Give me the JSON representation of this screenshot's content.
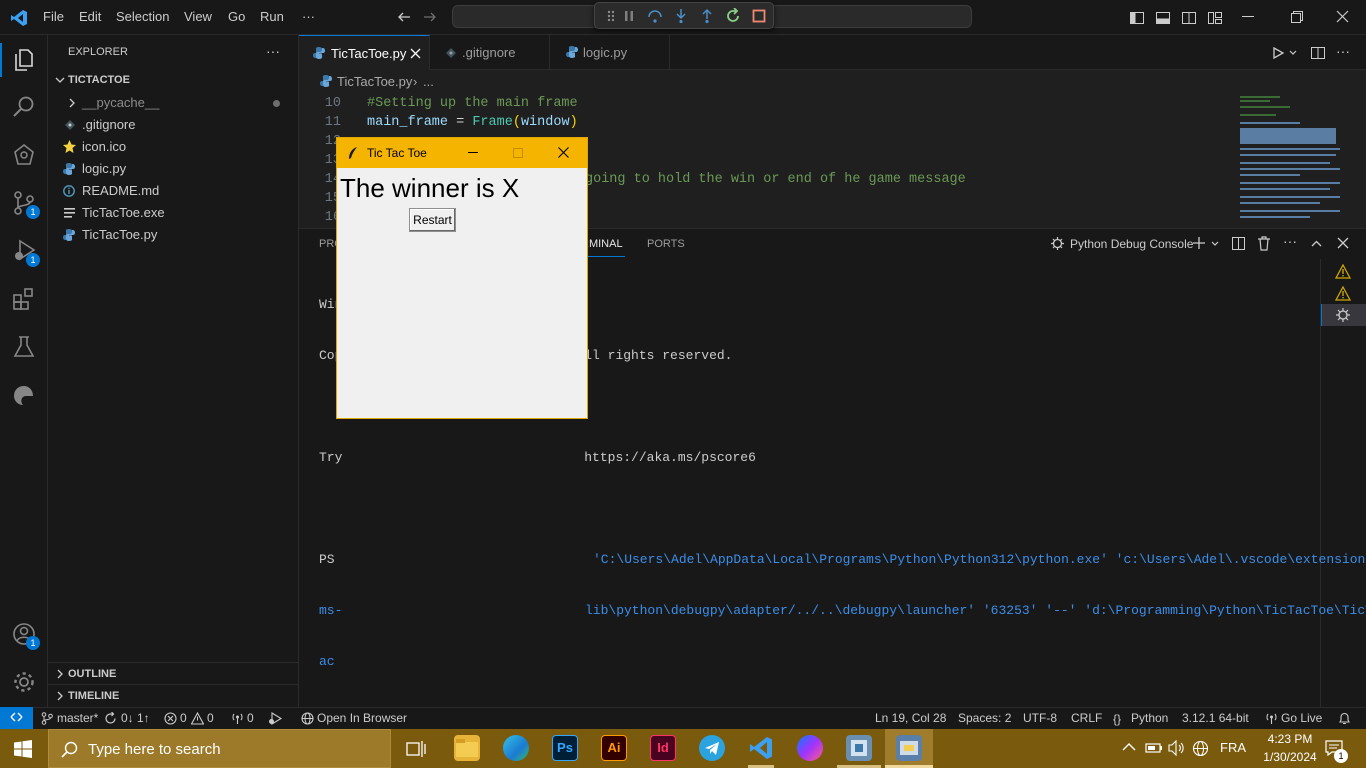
{
  "menu": [
    "File",
    "Edit",
    "Selection",
    "View",
    "Go",
    "Run",
    "···"
  ],
  "explorer": {
    "title": "EXPLORER",
    "more": "···",
    "root": "TICTACTOE",
    "items": [
      {
        "label": "__pycache__",
        "icon": "chevron-right"
      },
      {
        "label": ".gitignore",
        "icon": "git-diamond"
      },
      {
        "label": "icon.ico",
        "icon": "star"
      },
      {
        "label": "logic.py",
        "icon": "python"
      },
      {
        "label": "README.md",
        "icon": "info"
      },
      {
        "label": "TicTacToe.exe",
        "icon": "lines"
      },
      {
        "label": "TicTacToe.py",
        "icon": "python"
      }
    ],
    "outline": "OUTLINE",
    "timeline": "TIMELINE"
  },
  "activity_badges": {
    "scm": "1",
    "debug": "1",
    "accounts": "1"
  },
  "tabs": [
    {
      "label": "TicTacToe.py",
      "active": true
    },
    {
      "label": ".gitignore"
    },
    {
      "label": "logic.py"
    }
  ],
  "breadcrumb": {
    "file": "TicTacToe.py",
    "rest": "..."
  },
  "code": [
    {
      "n": "10",
      "text": "#Setting up the main frame"
    },
    {
      "n": "11",
      "text": "main_frame = Frame(window)"
    },
    {
      "n": "12",
      "text": ""
    },
    {
      "n": "13",
      "text": ""
    },
    {
      "n": "14",
      "text": "going to hold the win or end of he game message"
    },
    {
      "n": "15",
      "text": ""
    },
    {
      "n": "16",
      "text": ""
    }
  ],
  "panel": {
    "tab_problems": "PRO",
    "tab_terminal": "RMINAL",
    "tab_ports": "PORTS",
    "console": "Python Debug Console"
  },
  "terminal": [
    "Win",
    "Cop                               ll rights reserved.",
    "",
    "Try                               https://aka.ms/pscore6",
    "",
    "PS",
    "ms-",
    "ac"
  ],
  "terminal_cmd": [
    "'C:\\Users\\Adel\\AppData\\Local\\Programs\\Python\\Python312\\python.exe' 'c:\\Users\\Adel\\.vscode\\extensions\\",
    "lib\\python\\debugpy\\adapter/../..\\debugpy\\launcher' '63253' '--' 'd:\\Programming\\Python\\TicTacToe\\TicT"
  ],
  "tk": {
    "title": "Tic Tac Toe",
    "message": "The winner is X",
    "button": "Restart"
  },
  "status": {
    "branch": "master*",
    "sync": "0↓ 1↑",
    "errors": "0",
    "warnings": "0",
    "ports": "0",
    "open_browser": "Open In Browser",
    "position": "Ln 19, Col 28",
    "spaces": "Spaces: 2",
    "encoding": "UTF-8",
    "eol": "CRLF",
    "language": "Python",
    "interpreter": "3.12.1 64-bit",
    "golive": "Go Live"
  },
  "taskbar": {
    "search": "Type here to search",
    "lang": "FRA",
    "time": "4:23 PM",
    "date": "1/30/2024",
    "notif": "1"
  },
  "colors": {
    "accent": "#0078d4",
    "comment": "#6a9955",
    "taskbar": "#7a5a0d",
    "tk_title": "#f5b400"
  }
}
